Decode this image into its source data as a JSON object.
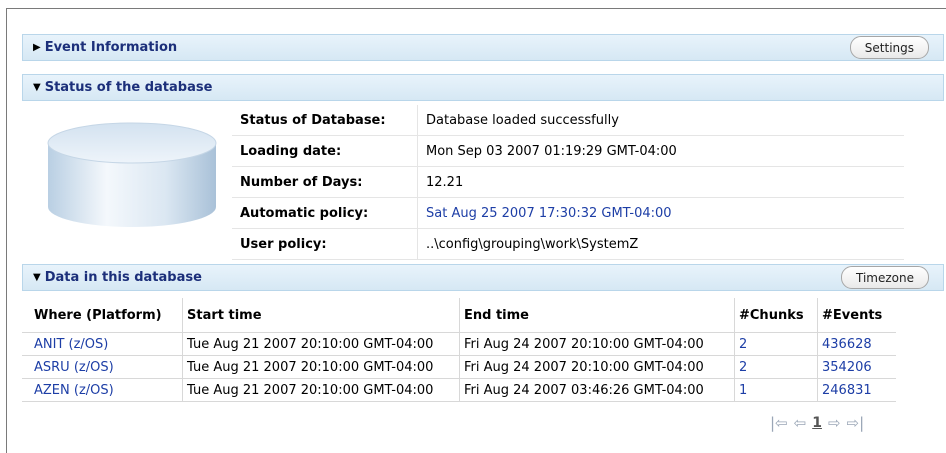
{
  "event_section": {
    "title": "Event Information",
    "settings_label": "Settings"
  },
  "status_section": {
    "title": "Status of the database",
    "rows": [
      {
        "label": "Status of Database:",
        "value": "Database loaded successfully"
      },
      {
        "label": "Loading date:",
        "value": "Mon Sep 03 2007 01:19:29 GMT-04:00"
      },
      {
        "label": "Number of Days:",
        "value": "12.21"
      },
      {
        "label": "Automatic policy:",
        "value": "Sat Aug 25 2007 17:30:32 GMT-04:00"
      },
      {
        "label": "User policy:",
        "value": "..\\config\\grouping\\work\\SystemZ"
      }
    ]
  },
  "data_section": {
    "title": "Data in this database",
    "timezone_label": "Timezone",
    "columns": [
      "Where (Platform)",
      "Start time",
      "End time",
      "#Chunks",
      "#Events"
    ],
    "rows": [
      {
        "where": "ANIT (z/OS)",
        "start": "Tue Aug 21 2007 20:10:00 GMT-04:00",
        "end": "Fri Aug 24 2007 20:10:00 GMT-04:00",
        "chunks": "2",
        "events": "436628"
      },
      {
        "where": "ASRU (z/OS)",
        "start": "Tue Aug 21 2007 20:10:00 GMT-04:00",
        "end": "Fri Aug 24 2007 20:10:00 GMT-04:00",
        "chunks": "2",
        "events": "354206"
      },
      {
        "where": "AZEN (z/OS)",
        "start": "Tue Aug 21 2007 20:10:00 GMT-04:00",
        "end": "Fri Aug 24 2007 03:46:26 GMT-04:00",
        "chunks": "1",
        "events": "246831"
      }
    ]
  },
  "pager": {
    "page": "1"
  },
  "colors": {
    "section_title": "#1c2f7a",
    "link": "#1d3ea6",
    "section_bg": "#dbeaf5"
  }
}
